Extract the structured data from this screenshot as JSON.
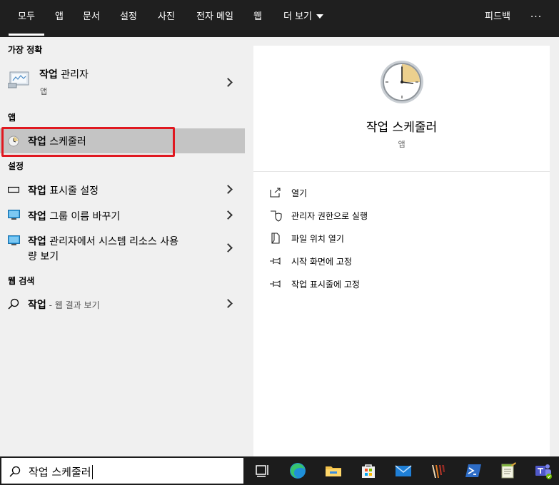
{
  "tabs": [
    {
      "label": "모두"
    },
    {
      "label": "앱"
    },
    {
      "label": "문서"
    },
    {
      "label": "설정"
    },
    {
      "label": "사진"
    },
    {
      "label": "전자 메일"
    },
    {
      "label": "웹"
    },
    {
      "label": "더 보기"
    }
  ],
  "topbar_right": {
    "feedback_label": "피드백",
    "more_label": "···"
  },
  "left": {
    "best_match_label": "가장 정확",
    "best_match": {
      "title_bold": "작업",
      "title_rest": " 관리자",
      "subtitle": "앱"
    },
    "apps_label": "앱",
    "app_item": {
      "title_bold": "작업",
      "title_rest": " 스케줄러"
    },
    "settings_label": "설정",
    "settings_items": [
      {
        "title_bold": "작업",
        "title_rest": " 표시줄 설정"
      },
      {
        "title_bold": "작업",
        "title_rest": " 그룹 이름 바꾸기"
      },
      {
        "title_bold": "작업",
        "title_rest": " 관리자에서 시스템 리소스 사용",
        "line2": "량 보기"
      }
    ],
    "web_label": "웹 검색",
    "web_item": {
      "title_bold": "작업",
      "title_rest": " - 웹 결과 보기"
    }
  },
  "detail": {
    "title": "작업 스케줄러",
    "subtitle": "앱",
    "actions": [
      {
        "label": "열기",
        "icon": "open-icon"
      },
      {
        "label": "관리자 권한으로 실행",
        "icon": "shield-icon"
      },
      {
        "label": "파일 위치 열기",
        "icon": "file-location-icon"
      },
      {
        "label": "시작 화면에 고정",
        "icon": "pin-icon"
      },
      {
        "label": "작업 표시줄에 고정",
        "icon": "pin-icon"
      }
    ]
  },
  "taskbar": {
    "search_value": "작업 스케줄러",
    "icons": [
      "task-view-icon",
      "edge-icon",
      "file-explorer-icon",
      "store-icon",
      "mail-icon",
      "app-icon",
      "powershell-icon",
      "notepad-icon",
      "teams-icon"
    ]
  },
  "colors": {
    "highlight": "#e01820",
    "selected_row": "#c4c4c4",
    "topbar": "#1f1f1f"
  }
}
